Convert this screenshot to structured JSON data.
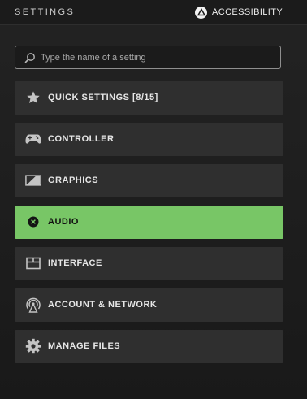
{
  "header": {
    "title": "SETTINGS",
    "accessibility_label": "ACCESSIBILITY",
    "accessibility_icon": "triangle-button-icon"
  },
  "search": {
    "placeholder": "Type the name of a setting",
    "value": "",
    "icon": "search-icon"
  },
  "menu": {
    "items": [
      {
        "label": "QUICK SETTINGS [8/15]",
        "icon": "star-icon",
        "active": false
      },
      {
        "label": "CONTROLLER",
        "icon": "gamepad-icon",
        "active": false
      },
      {
        "label": "GRAPHICS",
        "icon": "monitor-icon",
        "active": false
      },
      {
        "label": "AUDIO",
        "icon": "close-circle-icon",
        "active": true
      },
      {
        "label": "INTERFACE",
        "icon": "interface-icon",
        "active": false
      },
      {
        "label": "ACCOUNT & NETWORK",
        "icon": "network-antenna-icon",
        "active": false
      },
      {
        "label": "MANAGE FILES",
        "icon": "gear-icon",
        "active": false
      }
    ]
  },
  "colors": {
    "background": "#1f1f1f",
    "item_background": "#2f2f2f",
    "active_item": "#78c666",
    "text": "#e6e6e6"
  }
}
